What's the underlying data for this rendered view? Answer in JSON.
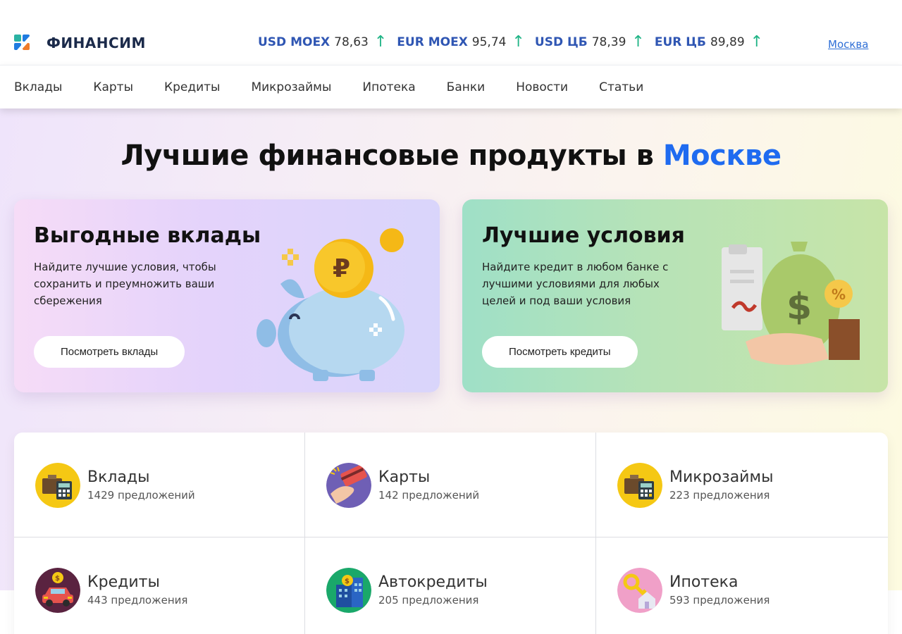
{
  "brand": {
    "name": "ФИНАНСИМ"
  },
  "rates": [
    {
      "label": "USD MOEX",
      "value": "78,63",
      "trend": "up-arrow-icon"
    },
    {
      "label": "EUR MOEX",
      "value": "95,74",
      "trend": "up-arrow-icon"
    },
    {
      "label": "USD ЦБ",
      "value": "78,39",
      "trend": "up-arrow-icon"
    },
    {
      "label": "EUR ЦБ",
      "value": "89,89",
      "trend": "up-arrow-icon"
    }
  ],
  "city": "Москва",
  "nav": {
    "items": [
      "Вклады",
      "Карты",
      "Кредиты",
      "Микрозаймы",
      "Ипотека",
      "Банки",
      "Новости",
      "Статьи"
    ]
  },
  "hero": {
    "title_prefix": "Лучшие финансовые продукты в ",
    "title_accent": "Москве"
  },
  "promos": {
    "deposits": {
      "title": "Выгодные вклады",
      "text": "Найдите лучшие условия, чтобы сохранить и преумножить ваши сбережения",
      "button": "Посмотреть вклады",
      "icon": "piggy-bank-icon"
    },
    "credits": {
      "title": "Лучшие условия",
      "text": "Найдите кредит в любом банке с лучшими условиями для любых целей и под ваши условия",
      "button": "Посмотреть кредиты",
      "icon": "money-bag-icon"
    }
  },
  "categories": [
    {
      "name": "Вклады",
      "count": "1429 предложений",
      "icon": "briefcase-calculator-icon"
    },
    {
      "name": "Карты",
      "count": "142 предложений",
      "icon": "card-hand-icon"
    },
    {
      "name": "Микрозаймы",
      "count": "223 предложения",
      "icon": "briefcase-calculator-icon"
    },
    {
      "name": "Кредиты",
      "count": "443 предложения",
      "icon": "car-coin-icon"
    },
    {
      "name": "Автокредиты",
      "count": "205 предложения",
      "icon": "building-coin-icon"
    },
    {
      "name": "Ипотека",
      "count": "593 предложения",
      "icon": "house-key-icon"
    }
  ],
  "colors": {
    "accent": "#1f6bf0",
    "rate_label": "#2f56b3",
    "trend_up": "#20b486",
    "brand_text": "#1b2a4a"
  }
}
